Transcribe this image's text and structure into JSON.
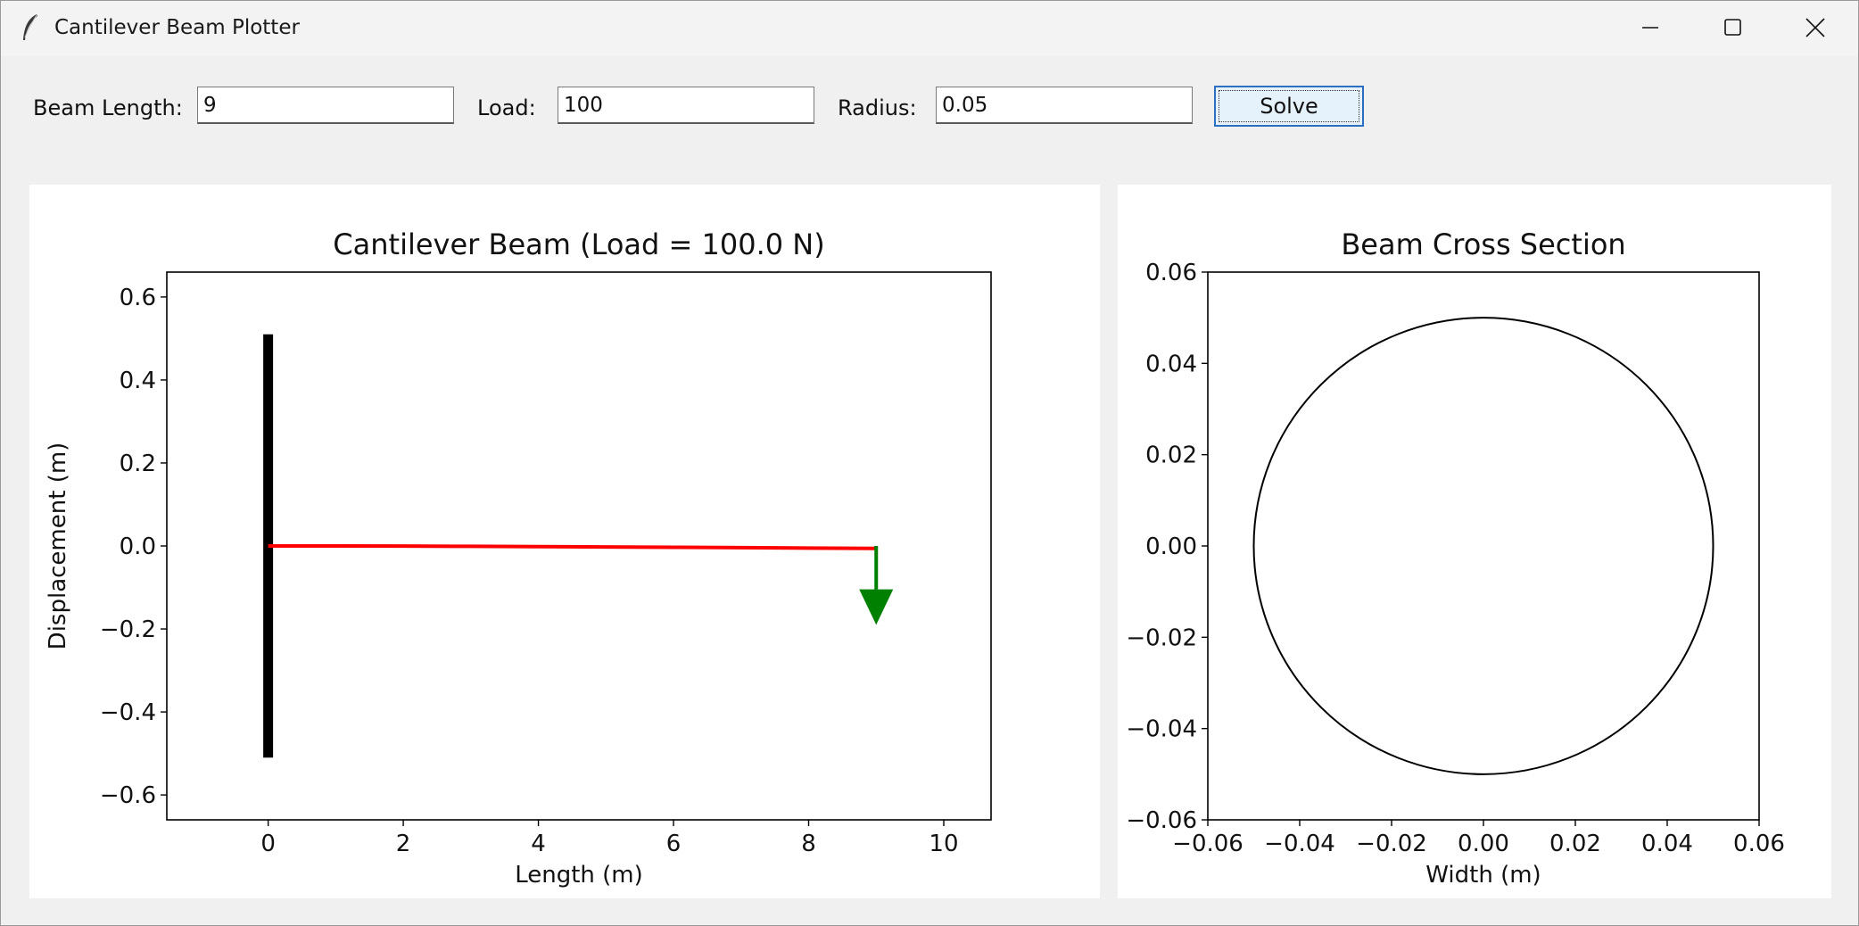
{
  "window": {
    "title": "Cantilever Beam Plotter"
  },
  "toolbar": {
    "beam_length_label": "Beam Length:",
    "beam_length_value": "9",
    "load_label": "Load:",
    "load_value": "100",
    "radius_label": "Radius:",
    "radius_value": "0.05",
    "solve_label": "Solve"
  },
  "chart_data": [
    {
      "type": "line",
      "title": "Cantilever Beam (Load = 100.0 N)",
      "xlabel": "Length (m)",
      "ylabel": "Displacement (m)",
      "xlim": [
        -1.5,
        10.7
      ],
      "ylim": [
        -0.66,
        0.66
      ],
      "xticks": [
        0,
        2,
        4,
        6,
        8,
        10
      ],
      "xtick_labels": [
        "0",
        "2",
        "4",
        "6",
        "8",
        "10"
      ],
      "yticks": [
        0.6,
        0.4,
        0.2,
        0.0,
        -0.2,
        -0.4,
        -0.6
      ],
      "ytick_labels": [
        "0.6",
        "0.4",
        "0.2",
        "0.0",
        "−0.2",
        "−0.4",
        "−0.6"
      ],
      "grid": false,
      "wall": {
        "x": 0,
        "y_from": -0.51,
        "y_to": 0.51,
        "color": "#000000"
      },
      "series": [
        {
          "x": [
            0,
            1,
            2,
            3,
            4,
            5,
            6,
            7,
            8,
            9
          ],
          "y": [
            0,
            -0.0001,
            -0.0004,
            -0.0009,
            -0.0016,
            -0.0024,
            -0.0032,
            -0.0041,
            -0.005,
            -0.006
          ],
          "color": "#ff0000"
        }
      ],
      "load_arrow": {
        "x": 9,
        "y_from": 0,
        "y_to": -0.19,
        "color": "#008000"
      }
    },
    {
      "type": "line",
      "title": "Beam Cross Section",
      "xlabel": "Width (m)",
      "ylabel": "",
      "xlim": [
        -0.06,
        0.06
      ],
      "ylim": [
        -0.06,
        0.06
      ],
      "xticks": [
        -0.06,
        -0.04,
        -0.02,
        0.0,
        0.02,
        0.04,
        0.06
      ],
      "xtick_labels": [
        "−0.06",
        "−0.04",
        "−0.02",
        "0.00",
        "0.02",
        "0.04",
        "0.06"
      ],
      "yticks": [
        0.06,
        0.04,
        0.02,
        0.0,
        -0.02,
        -0.04,
        -0.06
      ],
      "ytick_labels": [
        "0.06",
        "0.04",
        "0.02",
        "0.00",
        "−0.02",
        "−0.04",
        "−0.06"
      ],
      "grid": false,
      "circle": {
        "cx": 0,
        "cy": 0,
        "r": 0.05,
        "color": "#000000"
      }
    }
  ]
}
